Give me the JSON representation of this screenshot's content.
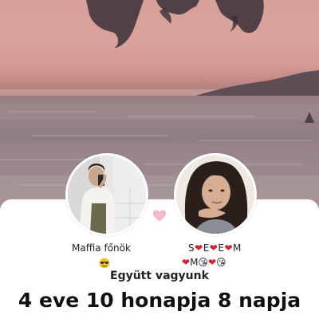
{
  "couple": {
    "partner_left": {
      "name": "Maffia főnök",
      "emoji_icon": "sunglasses-face-icon"
    },
    "partner_right": {
      "name_line1": "S❤E❤E❤M",
      "name_line2": "❤M😘❤😘"
    },
    "center_icon": "pink-heart-icon",
    "status_label": "Együtt vagyunk",
    "duration_text": "4 eve 10 honapja 8 napja"
  },
  "colors": {
    "heart_pink": "#f7b7d0",
    "red_heart": "#d3202a"
  }
}
